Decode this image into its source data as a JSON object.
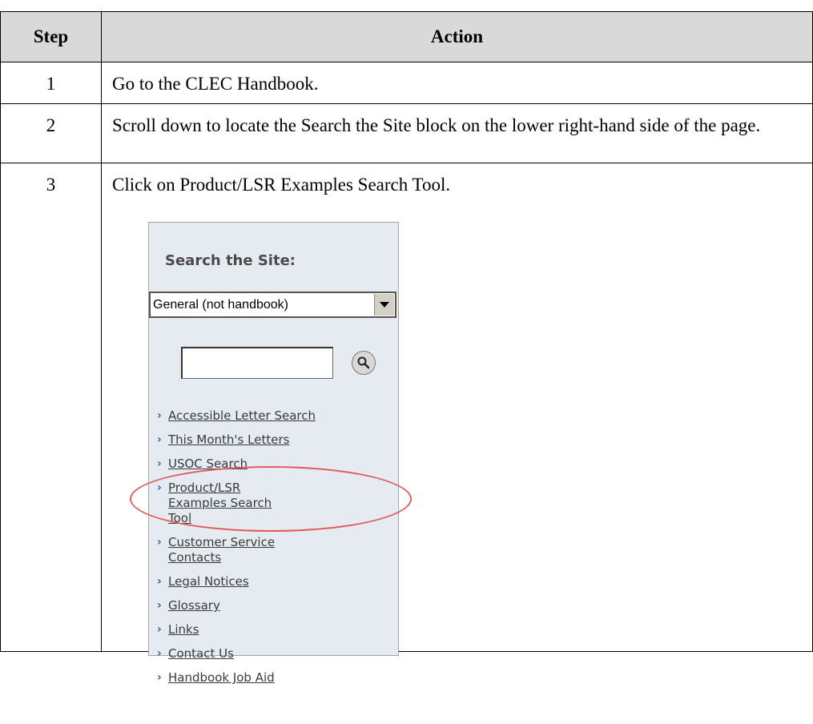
{
  "table": {
    "headers": [
      "Step",
      "Action"
    ],
    "rows": [
      {
        "step": "1",
        "action": "Go to the CLEC Handbook."
      },
      {
        "step": "2",
        "action": "Scroll down to locate the Search the Site block on the lower right-hand side of the page."
      },
      {
        "step": "3",
        "action": "Click on Product/LSR Examples Search Tool."
      }
    ]
  },
  "panel": {
    "title": "Search the Site:",
    "select_value": "General (not handbook)",
    "links": [
      "Accessible Letter Search",
      "This Month's Letters",
      "USOC Search",
      "Product/LSR Examples Search Tool",
      "Customer Service Contacts",
      "Legal Notices",
      "Glossary",
      "Links",
      "Contact Us",
      "Handbook Job Aid"
    ],
    "highlight_color": "#e05a5a"
  }
}
